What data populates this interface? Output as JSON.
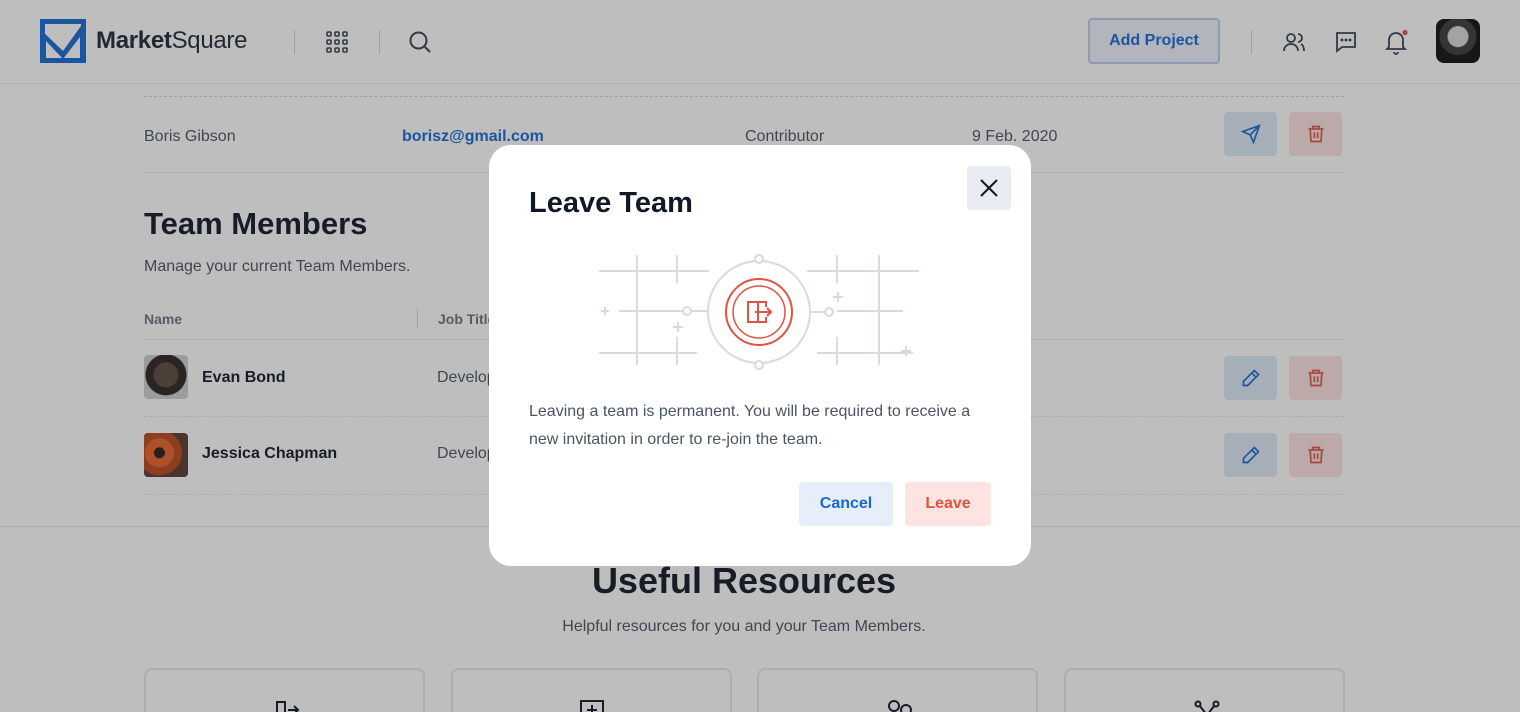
{
  "header": {
    "logo_bold": "Market",
    "logo_light": "Square",
    "add_project_label": "Add Project",
    "icons": [
      "apps-grid-icon",
      "search-icon",
      "users-icon",
      "chat-icon",
      "bell-icon"
    ],
    "notification_dot_color": "#e0533f"
  },
  "invites": {
    "row": {
      "name": "Boris Gibson",
      "email": "borisz@gmail.com",
      "role": "Contributor",
      "date": "9 Feb. 2020"
    }
  },
  "team": {
    "title": "Team Members",
    "subtitle": "Manage your current Team Members.",
    "columns": [
      "Name",
      "Job Title"
    ],
    "members": [
      {
        "name": "Evan Bond",
        "job": "Developer"
      },
      {
        "name": "Jessica Chapman",
        "job": "Developer"
      }
    ]
  },
  "resources": {
    "title": "Useful Resources",
    "subtitle": "Helpful resources for you and your Team Members."
  },
  "modal": {
    "title": "Leave Team",
    "body": "Leaving a team is permanent. You will be required to receive a new invitation in order to re-join the team.",
    "cancel_label": "Cancel",
    "leave_label": "Leave"
  },
  "colors": {
    "accent_blue": "#1769d3",
    "danger_red": "#e0533f"
  }
}
